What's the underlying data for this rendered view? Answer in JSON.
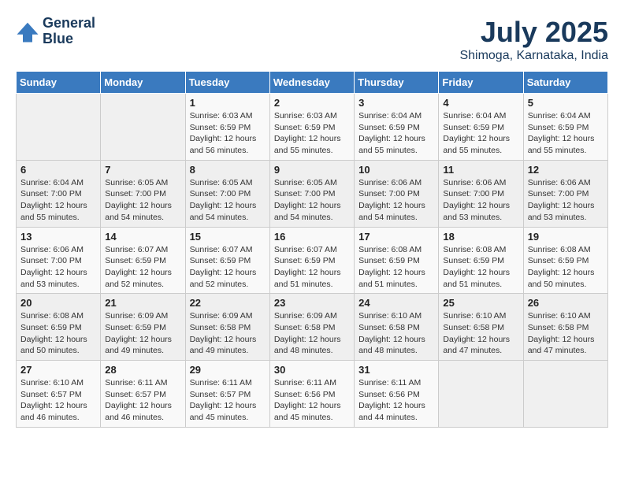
{
  "header": {
    "logo_line1": "General",
    "logo_line2": "Blue",
    "title": "July 2025",
    "subtitle": "Shimoga, Karnataka, India"
  },
  "days_of_week": [
    "Sunday",
    "Monday",
    "Tuesday",
    "Wednesday",
    "Thursday",
    "Friday",
    "Saturday"
  ],
  "weeks": [
    [
      {
        "day": "",
        "info": ""
      },
      {
        "day": "",
        "info": ""
      },
      {
        "day": "1",
        "sunrise": "6:03 AM",
        "sunset": "6:59 PM",
        "daylight": "12 hours and 56 minutes."
      },
      {
        "day": "2",
        "sunrise": "6:03 AM",
        "sunset": "6:59 PM",
        "daylight": "12 hours and 55 minutes."
      },
      {
        "day": "3",
        "sunrise": "6:04 AM",
        "sunset": "6:59 PM",
        "daylight": "12 hours and 55 minutes."
      },
      {
        "day": "4",
        "sunrise": "6:04 AM",
        "sunset": "6:59 PM",
        "daylight": "12 hours and 55 minutes."
      },
      {
        "day": "5",
        "sunrise": "6:04 AM",
        "sunset": "6:59 PM",
        "daylight": "12 hours and 55 minutes."
      }
    ],
    [
      {
        "day": "6",
        "sunrise": "6:04 AM",
        "sunset": "7:00 PM",
        "daylight": "12 hours and 55 minutes."
      },
      {
        "day": "7",
        "sunrise": "6:05 AM",
        "sunset": "7:00 PM",
        "daylight": "12 hours and 54 minutes."
      },
      {
        "day": "8",
        "sunrise": "6:05 AM",
        "sunset": "7:00 PM",
        "daylight": "12 hours and 54 minutes."
      },
      {
        "day": "9",
        "sunrise": "6:05 AM",
        "sunset": "7:00 PM",
        "daylight": "12 hours and 54 minutes."
      },
      {
        "day": "10",
        "sunrise": "6:06 AM",
        "sunset": "7:00 PM",
        "daylight": "12 hours and 54 minutes."
      },
      {
        "day": "11",
        "sunrise": "6:06 AM",
        "sunset": "7:00 PM",
        "daylight": "12 hours and 53 minutes."
      },
      {
        "day": "12",
        "sunrise": "6:06 AM",
        "sunset": "7:00 PM",
        "daylight": "12 hours and 53 minutes."
      }
    ],
    [
      {
        "day": "13",
        "sunrise": "6:06 AM",
        "sunset": "7:00 PM",
        "daylight": "12 hours and 53 minutes."
      },
      {
        "day": "14",
        "sunrise": "6:07 AM",
        "sunset": "6:59 PM",
        "daylight": "12 hours and 52 minutes."
      },
      {
        "day": "15",
        "sunrise": "6:07 AM",
        "sunset": "6:59 PM",
        "daylight": "12 hours and 52 minutes."
      },
      {
        "day": "16",
        "sunrise": "6:07 AM",
        "sunset": "6:59 PM",
        "daylight": "12 hours and 51 minutes."
      },
      {
        "day": "17",
        "sunrise": "6:08 AM",
        "sunset": "6:59 PM",
        "daylight": "12 hours and 51 minutes."
      },
      {
        "day": "18",
        "sunrise": "6:08 AM",
        "sunset": "6:59 PM",
        "daylight": "12 hours and 51 minutes."
      },
      {
        "day": "19",
        "sunrise": "6:08 AM",
        "sunset": "6:59 PM",
        "daylight": "12 hours and 50 minutes."
      }
    ],
    [
      {
        "day": "20",
        "sunrise": "6:08 AM",
        "sunset": "6:59 PM",
        "daylight": "12 hours and 50 minutes."
      },
      {
        "day": "21",
        "sunrise": "6:09 AM",
        "sunset": "6:59 PM",
        "daylight": "12 hours and 49 minutes."
      },
      {
        "day": "22",
        "sunrise": "6:09 AM",
        "sunset": "6:58 PM",
        "daylight": "12 hours and 49 minutes."
      },
      {
        "day": "23",
        "sunrise": "6:09 AM",
        "sunset": "6:58 PM",
        "daylight": "12 hours and 48 minutes."
      },
      {
        "day": "24",
        "sunrise": "6:10 AM",
        "sunset": "6:58 PM",
        "daylight": "12 hours and 48 minutes."
      },
      {
        "day": "25",
        "sunrise": "6:10 AM",
        "sunset": "6:58 PM",
        "daylight": "12 hours and 47 minutes."
      },
      {
        "day": "26",
        "sunrise": "6:10 AM",
        "sunset": "6:58 PM",
        "daylight": "12 hours and 47 minutes."
      }
    ],
    [
      {
        "day": "27",
        "sunrise": "6:10 AM",
        "sunset": "6:57 PM",
        "daylight": "12 hours and 46 minutes."
      },
      {
        "day": "28",
        "sunrise": "6:11 AM",
        "sunset": "6:57 PM",
        "daylight": "12 hours and 46 minutes."
      },
      {
        "day": "29",
        "sunrise": "6:11 AM",
        "sunset": "6:57 PM",
        "daylight": "12 hours and 45 minutes."
      },
      {
        "day": "30",
        "sunrise": "6:11 AM",
        "sunset": "6:56 PM",
        "daylight": "12 hours and 45 minutes."
      },
      {
        "day": "31",
        "sunrise": "6:11 AM",
        "sunset": "6:56 PM",
        "daylight": "12 hours and 44 minutes."
      },
      {
        "day": "",
        "info": ""
      },
      {
        "day": "",
        "info": ""
      }
    ]
  ]
}
